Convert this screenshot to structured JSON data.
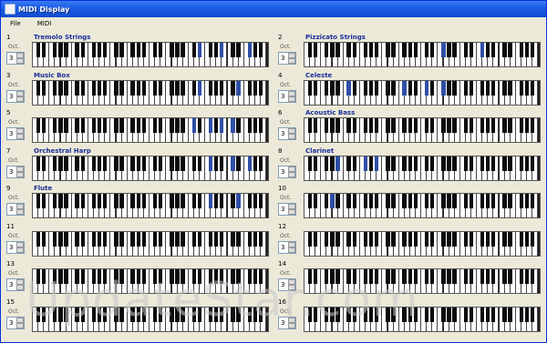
{
  "window": {
    "title": "MIDI Display"
  },
  "menu": [
    {
      "label": "File"
    },
    {
      "label": "MIDI"
    }
  ],
  "octave_label": "Oct.",
  "octave_label_alt": "Oct",
  "channels": [
    {
      "num": "1",
      "instrument": "Tremolo Strings",
      "octave": "3",
      "lit_black": [
        21,
        24,
        27
      ]
    },
    {
      "num": "2",
      "instrument": "Pizzicato Strings",
      "octave": "3",
      "lit_black": [
        17,
        22,
        30
      ]
    },
    {
      "num": "3",
      "instrument": "Music Box",
      "octave": "3",
      "lit_black": [
        21,
        26
      ]
    },
    {
      "num": "4",
      "instrument": "Celeste",
      "octave": "3",
      "lit_black": [
        5,
        12,
        15,
        17
      ]
    },
    {
      "num": "5",
      "instrument": "",
      "octave": "3",
      "lit_black": [
        20,
        22,
        24,
        25
      ]
    },
    {
      "num": "6",
      "instrument": "Acoustic Bass",
      "octave": "3",
      "lit_black": []
    },
    {
      "num": "7",
      "instrument": "Orchestral Harp",
      "octave": "3",
      "lit_black": [
        22,
        25,
        27
      ]
    },
    {
      "num": "8",
      "instrument": "Clarinet",
      "octave": "3",
      "lit_black": [
        4,
        7,
        9
      ]
    },
    {
      "num": "9",
      "instrument": "Flute",
      "octave": "3",
      "lit_black": [
        22,
        26,
        30
      ]
    },
    {
      "num": "10",
      "instrument": "",
      "octave": "3",
      "lit_black": [
        3
      ]
    },
    {
      "num": "11",
      "instrument": "",
      "octave": "3",
      "lit_black": []
    },
    {
      "num": "12",
      "instrument": "",
      "octave": "3",
      "lit_black": []
    },
    {
      "num": "13",
      "instrument": "",
      "octave": "3",
      "lit_black": []
    },
    {
      "num": "14",
      "instrument": "",
      "octave": "3",
      "lit_black": []
    },
    {
      "num": "15",
      "instrument": "",
      "octave": "3",
      "lit_black": []
    },
    {
      "num": "16",
      "instrument": "",
      "octave": "3",
      "lit_black": []
    }
  ],
  "watermark": "UpdateStar.com"
}
